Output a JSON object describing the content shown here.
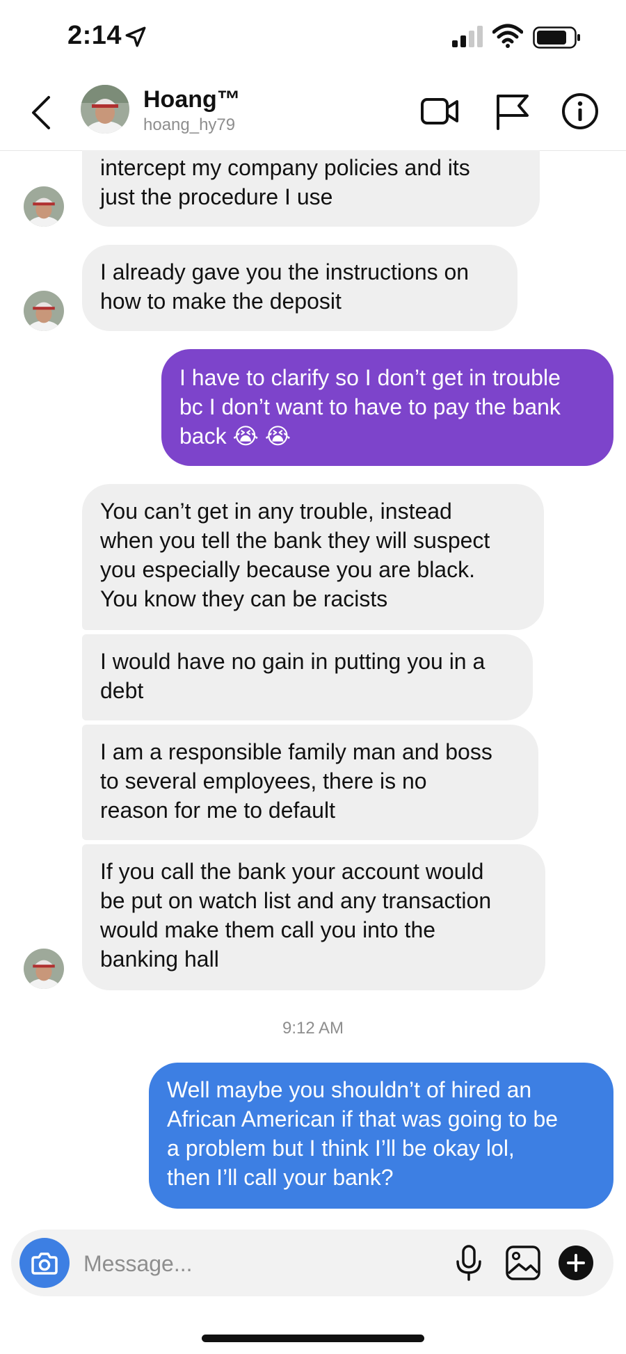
{
  "status_bar": {
    "time": "2:14",
    "icons": [
      "location-arrow-icon",
      "cellular-signal-icon",
      "wifi-icon",
      "battery-icon"
    ]
  },
  "header": {
    "name": "Hoang™",
    "username": "hoang_hy79",
    "icons": [
      "back-chevron-icon",
      "video-call-icon",
      "flag-icon",
      "info-icon"
    ]
  },
  "messages": [
    {
      "lines": [
        "intercept my company policies and its",
        "just the procedure I use"
      ]
    },
    {
      "lines": [
        "I already gave you the instructions on",
        "how to make the deposit"
      ]
    },
    {
      "lines": [
        "I have to clarify so I don’t get in trouble",
        "bc I don’t want to have to pay the bank",
        "back 😭 😭"
      ]
    },
    {
      "lines": [
        "You can’t get in any trouble, instead",
        "when you tell the bank they will suspect",
        "you especially because you are black.",
        "You know they can be racists"
      ]
    },
    {
      "lines": [
        "I would have no gain in putting you in a",
        "debt"
      ]
    },
    {
      "lines": [
        "I am a responsible family man and boss",
        "to several employees, there is no",
        "reason for me to default"
      ]
    },
    {
      "lines": [
        "If you call the bank your account would",
        "be put on watch list and any transaction",
        "would make them call you into the",
        "banking hall"
      ]
    },
    {
      "lines": [
        "Well maybe you shouldn’t of hired an",
        "African American if that was going to be",
        "a problem but I think I’ll be okay lol,",
        "then I’ll call your bank?"
      ]
    }
  ],
  "timestamp": "9:12 AM",
  "composer": {
    "placeholder": "Message...",
    "icons": [
      "camera-icon",
      "microphone-icon",
      "gallery-icon",
      "plus-icon"
    ]
  },
  "colors": {
    "outgoing_purple": "#7d44cb",
    "outgoing_blue": "#3d7fe3",
    "incoming": "#efefef"
  }
}
